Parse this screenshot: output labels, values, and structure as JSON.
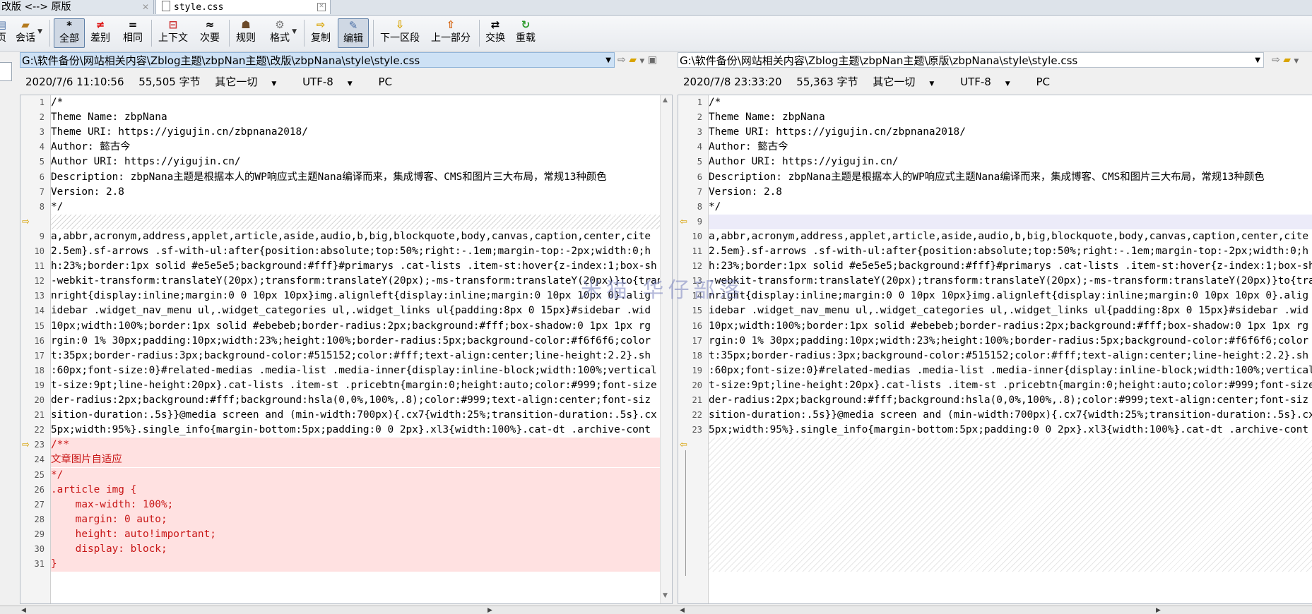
{
  "tabs": [
    {
      "label": "改版 <--> 原版"
    },
    {
      "label": "style.css"
    }
  ],
  "toolbar": {
    "items": [
      {
        "label": "页",
        "icon": "page-icon"
      },
      {
        "label": "会话",
        "icon": "session-icon"
      },
      {
        "label": "全部",
        "icon": "asterisk-icon"
      },
      {
        "label": "差别",
        "icon": "not-equal-icon"
      },
      {
        "label": "相同",
        "icon": "equal-icon"
      },
      {
        "label": "上下文",
        "icon": "context-icon"
      },
      {
        "label": "次要",
        "icon": "approx-icon"
      },
      {
        "label": "规则",
        "icon": "rules-icon"
      },
      {
        "label": "格式",
        "icon": "format-icon"
      },
      {
        "label": "复制",
        "icon": "copy-arrow-icon"
      },
      {
        "label": "编辑",
        "icon": "edit-icon"
      },
      {
        "label": "下一区段",
        "icon": "down-arrow-icon"
      },
      {
        "label": "上一部分",
        "icon": "up-arrow-icon"
      },
      {
        "label": "交换",
        "icon": "swap-icon"
      },
      {
        "label": "重载",
        "icon": "reload-icon"
      }
    ]
  },
  "left": {
    "path": "G:\\软件备份\\网站相关内容\\Zblog主题\\zbpNan主题\\改版\\zbpNana\\style\\style.css",
    "info": {
      "datetime": "2020/7/6 11:10:56",
      "size": "55,505 字节",
      "type": "其它一切",
      "encoding": "UTF-8",
      "lineend": "PC"
    }
  },
  "right": {
    "path": "G:\\软件备份\\网站相关内容\\Zblog主题\\zbpNan主题\\原版\\zbpNana\\style\\style.css",
    "info": {
      "datetime": "2020/7/8 23:33:20",
      "size": "55,363 字节",
      "type": "其它一切",
      "encoding": "UTF-8",
      "lineend": "PC"
    }
  },
  "header_lines": [
    {
      "n": "1",
      "t": "/*"
    },
    {
      "n": "2",
      "t": "Theme Name: zbpNana"
    },
    {
      "n": "3",
      "t": "Theme URI: https://yigujin.cn/zbpnana2018/"
    },
    {
      "n": "4",
      "t": "Author: 懿古今"
    },
    {
      "n": "5",
      "t": "Author URI: https://yigujin.cn/"
    },
    {
      "n": "6",
      "t": "Description: zbpNana主题是根据本人的WP响应式主题Nana编译而来，集成博客、CMS和图片三大布局，常规13种颜色"
    },
    {
      "n": "7",
      "t": "Version: 2.8"
    },
    {
      "n": "8",
      "t": "*/"
    }
  ],
  "right_extra_line": {
    "n": "9"
  },
  "body_lines": [
    {
      "l": "9",
      "r": "10",
      "t": "a,abbr,acronym,address,applet,article,aside,audio,b,big,blockquote,body,canvas,caption,center,cite"
    },
    {
      "l": "10",
      "r": "11",
      "t": "2.5em}.sf-arrows .sf-with-ul:after{position:absolute;top:50%;right:-.1em;margin-top:-2px;width:0;h"
    },
    {
      "l": "11",
      "r": "12",
      "t": "h:23%;border:1px solid #e5e5e5;background:#fff}#primarys .cat-lists .item-st:hover{z-index:1;box-sh"
    },
    {
      "l": "12",
      "r": "13",
      "t": "-webkit-transform:translateY(20px);transform:translateY(20px);-ms-transform:translateY(20px)}to{tran"
    },
    {
      "l": "13",
      "r": "14",
      "t": "nright{display:inline;margin:0 0 10px 10px}img.alignleft{display:inline;margin:0 10px 10px 0}.alig"
    },
    {
      "l": "14",
      "r": "15",
      "t": "idebar .widget_nav_menu ul,.widget_categories ul,.widget_links ul{padding:8px 0 15px}#sidebar .wid"
    },
    {
      "l": "15",
      "r": "16",
      "t": "10px;width:100%;border:1px solid #ebebeb;border-radius:2px;background:#fff;box-shadow:0 1px 1px rg"
    },
    {
      "l": "16",
      "r": "17",
      "t": "rgin:0 1% 30px;padding:10px;width:23%;height:100%;border-radius:5px;background-color:#f6f6f6;color"
    },
    {
      "l": "17",
      "r": "18",
      "t": "t:35px;border-radius:3px;background-color:#515152;color:#fff;text-align:center;line-height:2.2}.sh"
    },
    {
      "l": "18",
      "r": "19",
      "t": ":60px;font-size:0}#related-medias .media-list .media-inner{display:inline-block;width:100%;vertical"
    },
    {
      "l": "19",
      "r": "20",
      "t": "t-size:9pt;line-height:20px}.cat-lists .item-st .pricebtn{margin:0;height:auto;color:#999;font-size"
    },
    {
      "l": "20",
      "r": "21",
      "t": "der-radius:2px;background:#fff;background:hsla(0,0%,100%,.8);color:#999;text-align:center;font-siz"
    },
    {
      "l": "21",
      "r": "22",
      "t": "sition-duration:.5s}}@media screen and (min-width:700px){.cx7{width:25%;transition-duration:.5s}.cx"
    },
    {
      "l": "22",
      "r": "23",
      "t": "5px;width:95%}.single_info{margin-bottom:5px;padding:0 0 2px}.xl3{width:100%}.cat-dt .archive-cont"
    }
  ],
  "added_lines": [
    {
      "n": "23",
      "t": "/**"
    },
    {
      "n": "24",
      "t": "文章图片自适应"
    },
    {
      "n": "25",
      "t": "*/"
    },
    {
      "n": "26",
      "t": ".article img {"
    },
    {
      "n": "27",
      "t": "    max-width: 100%;"
    },
    {
      "n": "28",
      "t": "    margin: 0 auto;"
    },
    {
      "n": "29",
      "t": "    height: auto!important;"
    },
    {
      "n": "30",
      "t": "    display: block;"
    },
    {
      "n": "31",
      "t": "}"
    }
  ],
  "watermark": "米猫 华仔部落",
  "colors": {
    "added_bg": "#ffe1e1",
    "added_text": "#c81616",
    "path_highlight": "#cde1f5",
    "marker": "#d7a100"
  }
}
